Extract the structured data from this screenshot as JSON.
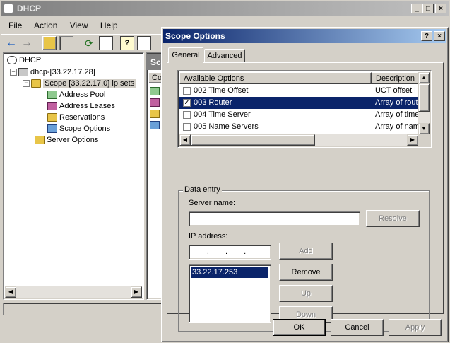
{
  "main_window": {
    "title": "DHCP",
    "menu": [
      "File",
      "Action",
      "View",
      "Help"
    ],
    "tree": [
      {
        "label": "DHCP"
      },
      {
        "label": "dhcp-[33.22.17.28]"
      },
      {
        "label": "Scope [33.22.17.0] ip sets"
      },
      {
        "label": "Address Pool"
      },
      {
        "label": "Address Leases"
      },
      {
        "label": "Reservations"
      },
      {
        "label": "Scope Options"
      },
      {
        "label": "Server Options"
      }
    ],
    "right_header": "Sc",
    "right_col": "Co"
  },
  "dialog": {
    "title": "Scope Options",
    "tabs": [
      "General",
      "Advanced"
    ],
    "options_table": {
      "columns": [
        "Available Options",
        "Description"
      ],
      "rows": [
        {
          "label": "002 Time Offset",
          "desc": "UCT offset i",
          "checked": false,
          "selected": false
        },
        {
          "label": "003 Router",
          "desc": "Array of rout",
          "checked": true,
          "selected": true
        },
        {
          "label": "004 Time Server",
          "desc": "Array of time",
          "checked": false,
          "selected": false
        },
        {
          "label": "005 Name Servers",
          "desc": "Array of nam",
          "checked": false,
          "selected": false
        }
      ]
    },
    "data_entry": {
      "group_label": "Data entry",
      "server_name_label": "Server name:",
      "server_name_value": "",
      "resolve": "Resolve",
      "ip_label": "IP address:",
      "ip_value": ". . .",
      "add": "Add",
      "remove": "Remove",
      "up": "Up",
      "down": "Down",
      "ip_list": [
        "33.22.17.253"
      ]
    },
    "buttons": {
      "ok": "OK",
      "cancel": "Cancel",
      "apply": "Apply"
    }
  }
}
